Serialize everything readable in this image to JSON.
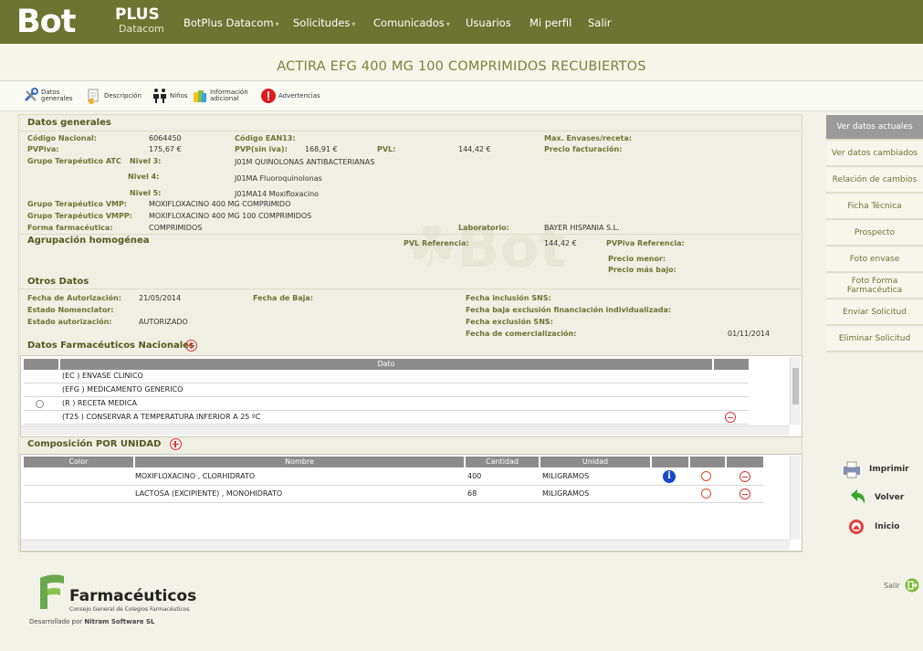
{
  "app": {
    "logo_main": "Bot",
    "logo_plus": "PLUS",
    "logo_sub": "Datacom"
  },
  "nav": {
    "items": [
      {
        "label": "BotPlus Datacom",
        "has_caret": true
      },
      {
        "label": "Solicitudes",
        "has_caret": true
      },
      {
        "label": "Comunicados",
        "has_caret": true
      },
      {
        "label": "Usuarios",
        "has_caret": false
      },
      {
        "label": "Mi perfil",
        "has_caret": false
      },
      {
        "label": "Salir",
        "has_caret": false
      }
    ]
  },
  "page_title": "ACTIRA EFG 400 MG 100 COMPRIMIDOS RECUBIERTOS",
  "toolbar": {
    "datos_generales_1": "Datos",
    "datos_generales_2": "generales",
    "descripcion": "Descripción",
    "ninos": "Niños",
    "info_1": "Información",
    "info_2": "adicional",
    "advertencias": "Advertencias"
  },
  "datos_generales": {
    "title": "Datos generales",
    "codigo_nacional_lbl": "Código Nacional:",
    "codigo_nacional": "6064450",
    "codigo_ean_lbl": "Código EAN13:",
    "max_envases_lbl": "Max. Envases/receta:",
    "pvpiva_lbl": "PVPiva:",
    "pvpiva": "175,67 €",
    "pvp_sin_iva_lbl": "PVP(sin iva):",
    "pvp_sin_iva": "168,91 €",
    "pvl_lbl": "PVL:",
    "pvl": "144,42 €",
    "precio_facturacion_lbl": "Precio facturación:",
    "grupo_atc_lbl": "Grupo Terapéutico ATC",
    "nivel3_lbl": "Nivel 3:",
    "nivel3": "J01M QUINOLONAS ANTIBACTERIANAS",
    "nivel4_lbl": "Nivel 4:",
    "nivel4": "J01MA Fluoroquinolonas",
    "nivel5_lbl": "Nivel 5:",
    "nivel5": "J01MA14 Moxifloxacino",
    "vmp_lbl": "Grupo Terapéutico VMP:",
    "vmp": "MOXIFLOXACINO 400 MG COMPRIMIDO",
    "vmpp_lbl": "Grupo Terapéutico VMPP:",
    "vmpp": "MOXIFLOXACINO 400 MG 100 COMPRIMIDOS",
    "forma_lbl": "Forma farmacéutica:",
    "forma": "COMPRIMIDOS",
    "laboratorio_lbl": "Laboratorio:",
    "laboratorio": "BAYER HISPANIA S.L."
  },
  "agrupacion": {
    "title": "Agrupación homogénea",
    "pvl_ref_lbl": "PVL Referencia:",
    "pvl_ref": "144,42 €",
    "pvpiva_ref_lbl": "PVPiva Referencia:",
    "precio_menor_lbl": "Precio menor:",
    "precio_mas_bajo_lbl": "Precio más bajo:"
  },
  "otros": {
    "title": "Otros Datos",
    "fecha_autorizacion_lbl": "Fecha de Autorización:",
    "fecha_autorizacion": "21/05/2014",
    "fecha_baja_lbl": "Fecha de Baja:",
    "estado_nomenclator_lbl": "Estado Nomenclator:",
    "estado_autorizacion_lbl": "Estado autorización:",
    "estado_autorizacion": "AUTORIZADO",
    "fecha_inclusion_lbl": "Fecha inclusión SNS:",
    "fecha_baja_excl_lbl": "Fecha baja exclusión financiación individualizada:",
    "fecha_exclusion_lbl": "Fecha exclusión SNS:",
    "fecha_comercializacion_lbl": "Fecha de comercialización:",
    "fecha_comercializacion": "01/11/2014"
  },
  "nacionales": {
    "title": "Datos Farmacéuticos Nacionales",
    "col_dato": "Dato",
    "rows": [
      "(EC ) ENVASE CLINICO",
      "(EFG ) MEDICAMENTO GENERICO",
      "(R ) RECETA MEDICA",
      "(T25 ) CONSERVAR A TEMPERATURA INFERIOR A 25 ºC"
    ]
  },
  "composicion": {
    "title": "Composición POR UNIDAD",
    "col_color": "Color",
    "col_nombre": "Nombre",
    "col_cantidad": "Cantidad",
    "col_unidad": "Unidad",
    "rows": [
      {
        "nombre": "MOXIFLOXACINO , CLORHIDRATO",
        "cantidad": "400",
        "unidad": "MILIGRAMOS"
      },
      {
        "nombre": "LACTOSA (EXCIPIENTE) , MONOHIDRATO",
        "cantidad": "68",
        "unidad": "MILIGRAMOS"
      }
    ]
  },
  "sidebar": {
    "buttons": [
      "Ver datos actuales",
      "Ver datos cambiados",
      "Relación de cambios",
      "Ficha Técnica",
      "Prospecto",
      "Foto envase",
      "Foto Forma Farmacéutica",
      "Enviar Solicitud",
      "Eliminar Solicitud"
    ],
    "imprimir": "Imprimir",
    "volver": "Volver",
    "inicio": "Inicio"
  },
  "footer": {
    "brand": "Farmacéuticos",
    "subtitle": "Consejo General de Colegios Farmacéuticos",
    "dev_prefix": "Desarrollado por",
    "dev_name": "Nitram Software SL",
    "salir": "Salir"
  },
  "colors": {
    "accent": "#6c7431",
    "background": "#f3f2e8",
    "alert": "#dd2222"
  }
}
